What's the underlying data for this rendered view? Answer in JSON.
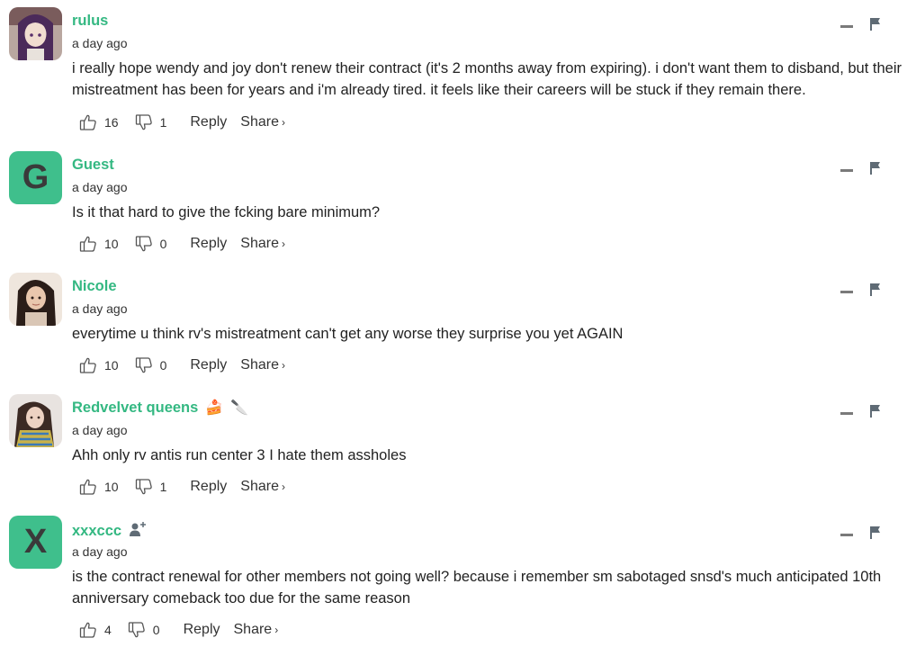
{
  "comments": [
    {
      "author": "rulus",
      "time": "a day ago",
      "avatar": {
        "type": "image",
        "desc": "anime-avatar"
      },
      "text": "i really hope wendy and joy don't renew their contract (it's 2 months away from expiring). i don't want them to disband, but their mistreatment has been for years and i'm already tired. it feels like their careers will be stuck if they remain there.",
      "likes": "16",
      "dislikes": "1",
      "reply": "Reply",
      "share": "Share"
    },
    {
      "author": "Guest",
      "time": "a day ago",
      "avatar": {
        "type": "letter",
        "letter": "G"
      },
      "text": "Is it that hard to give the fcking bare minimum?",
      "likes": "10",
      "dislikes": "0",
      "reply": "Reply",
      "share": "Share"
    },
    {
      "author": "Nicole",
      "time": "a day ago",
      "avatar": {
        "type": "image",
        "desc": "photo-avatar"
      },
      "text": "everytime u think rv's mistreatment can't get any worse they surprise you yet AGAIN",
      "likes": "10",
      "dislikes": "0",
      "reply": "Reply",
      "share": "Share"
    },
    {
      "author": "Redvelvet queens",
      "time": "a day ago",
      "avatar": {
        "type": "image",
        "desc": "photo-avatar"
      },
      "badges": [
        "🍰",
        "🔪"
      ],
      "text": "Ahh only rv antis run center 3 I hate them assholes",
      "likes": "10",
      "dislikes": "1",
      "reply": "Reply",
      "share": "Share"
    },
    {
      "author": "xxxccc",
      "time": "a day ago",
      "avatar": {
        "type": "letter",
        "letter": "X"
      },
      "badge_icon": "user-plus-icon",
      "text": "is the contract renewal for other members not going well? because i remember sm sabotaged snsd's much anticipated 10th anniversary comeback too due for the same reason",
      "likes": "4",
      "dislikes": "0",
      "reply": "Reply",
      "share": "Share"
    }
  ],
  "colors": {
    "author": "#34b882",
    "avatar_bg": "#3fbf8c"
  }
}
